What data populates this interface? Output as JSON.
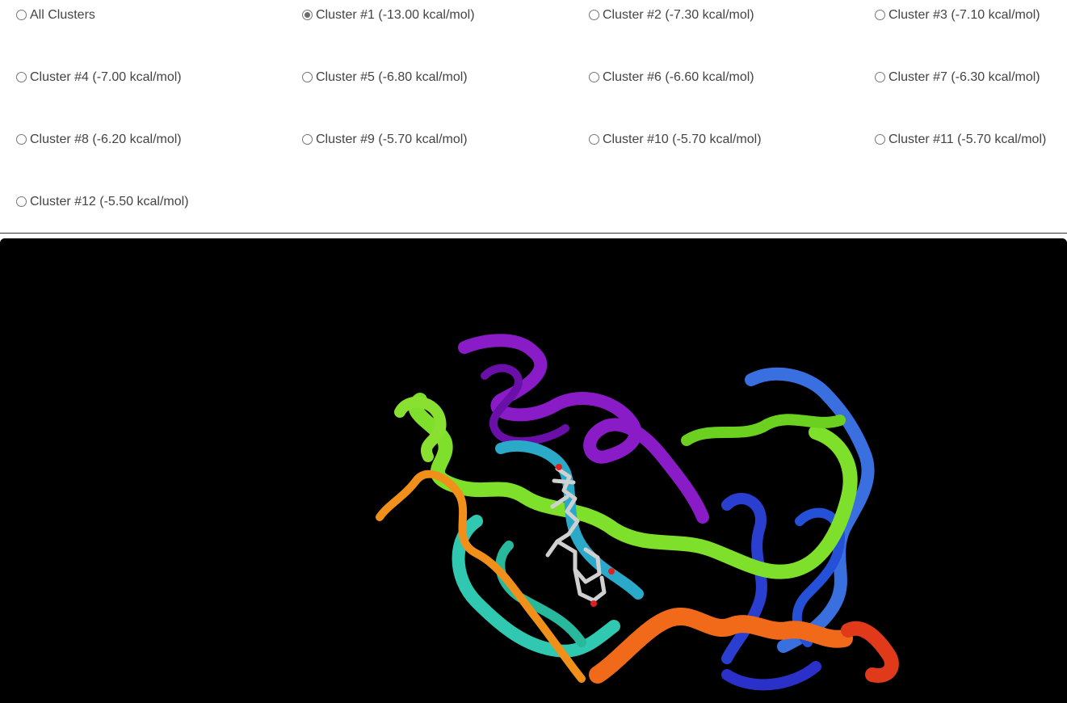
{
  "clusters": {
    "selected_index": 1,
    "options": [
      {
        "label": "All Clusters"
      },
      {
        "label": "Cluster #1 (-13.00 kcal/mol)"
      },
      {
        "label": "Cluster #2 (-7.30 kcal/mol)"
      },
      {
        "label": "Cluster #3 (-7.10 kcal/mol)"
      },
      {
        "label": "Cluster #4 (-7.00 kcal/mol)"
      },
      {
        "label": "Cluster #5 (-6.80 kcal/mol)"
      },
      {
        "label": "Cluster #6 (-6.60 kcal/mol)"
      },
      {
        "label": "Cluster #7 (-6.30 kcal/mol)"
      },
      {
        "label": "Cluster #8 (-6.20 kcal/mol)"
      },
      {
        "label": "Cluster #9 (-5.70 kcal/mol)"
      },
      {
        "label": "Cluster #10 (-5.70 kcal/mol)"
      },
      {
        "label": "Cluster #11 (-5.70 kcal/mol)"
      },
      {
        "label": "Cluster #12 (-5.50 kcal/mol)"
      }
    ]
  },
  "viewer": {
    "background": "#000000",
    "ribbon_colors": [
      "#8a1cc8",
      "#3a6fe0",
      "#2a3fd0",
      "#7ee02a",
      "#2aa9c8",
      "#30c8b0",
      "#f0901a",
      "#f06a1a",
      "#e03a1a"
    ],
    "ligand_color": "#d0d0d0",
    "oxygen_color": "#e02020"
  }
}
